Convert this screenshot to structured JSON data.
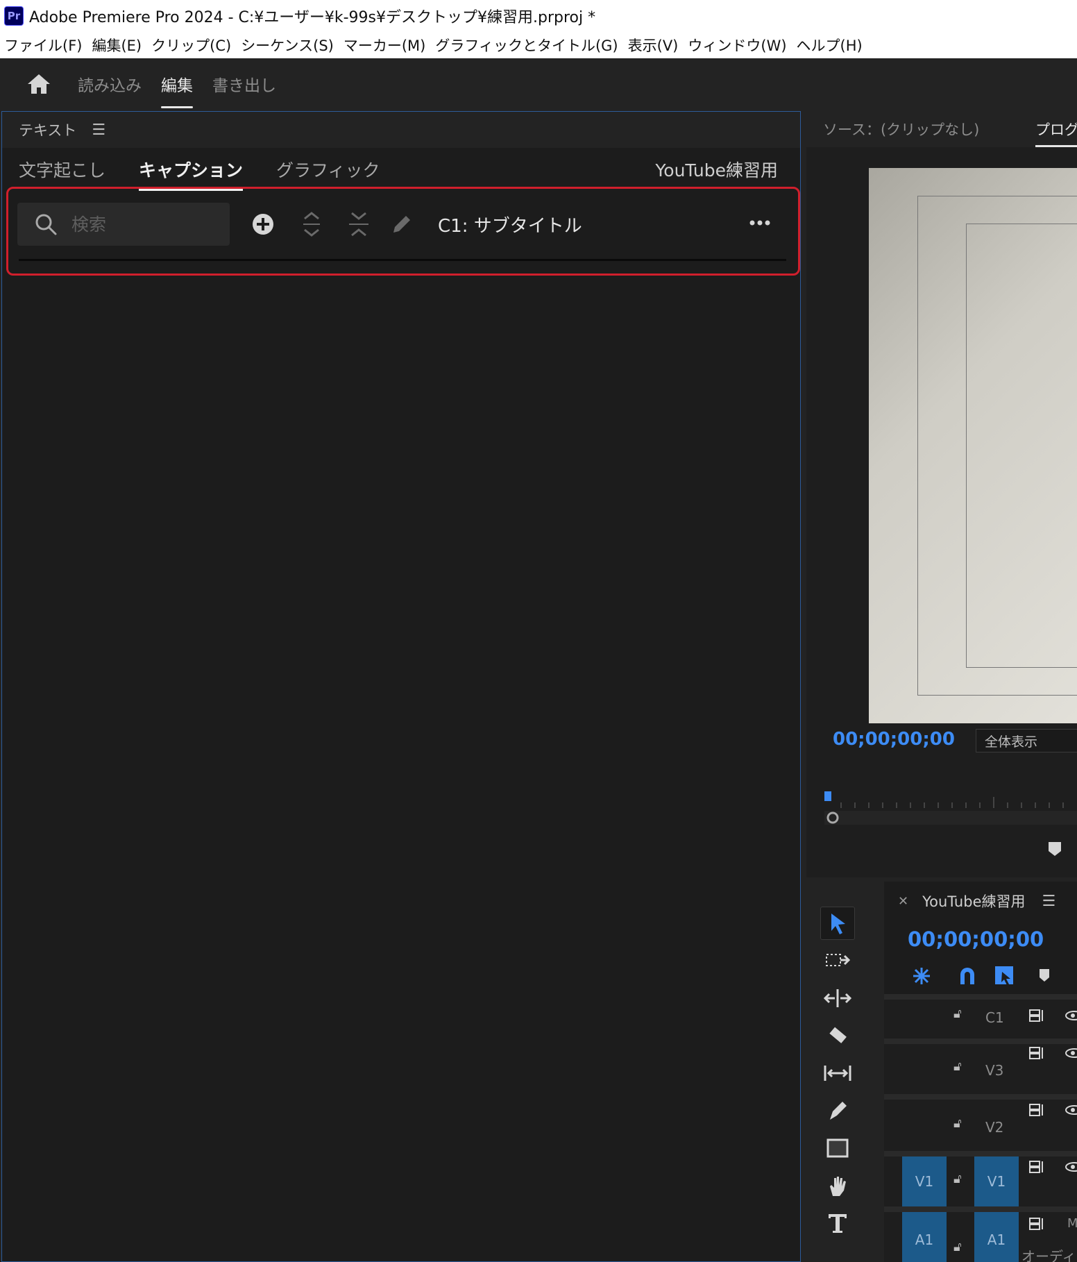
{
  "app": {
    "logo": "Pr",
    "title": "Adobe Premiere Pro 2024 - C:¥ユーザー¥k-99s¥デスクトップ¥練習用.prproj *"
  },
  "menu": [
    "ファイル(F)",
    "編集(E)",
    "クリップ(C)",
    "シーケンス(S)",
    "マーカー(M)",
    "グラフィックとタイトル(G)",
    "表示(V)",
    "ウィンドウ(W)",
    "ヘルプ(H)"
  ],
  "workspace": {
    "tabs": [
      "読み込み",
      "編集",
      "書き出し"
    ],
    "active": "編集"
  },
  "text_panel": {
    "title": "テキスト",
    "tabs": [
      "文字起こし",
      "キャプション",
      "グラフィック"
    ],
    "active_tab": "キャプション",
    "sequence_name": "YouTube練習用",
    "search_placeholder": "検索",
    "caption_track": "C1: サブタイトル"
  },
  "monitor": {
    "source_tab": "ソース：(クリップなし)",
    "program_tab": "プログ",
    "timecode": "00;00;00;00",
    "fit": "全体表示"
  },
  "timeline": {
    "name": "YouTube練習用",
    "timecode": "00;00;00;00",
    "tracks": {
      "c1": "C1",
      "v3": "V3",
      "v2": "V2",
      "v1_source": "V1",
      "v1": "V1",
      "a1_source": "A1",
      "a1": "A1",
      "audio_label": "オーディ",
      "m": "M"
    }
  },
  "colors": {
    "accent": "#3d8cf5",
    "highlight": "#d01f2c",
    "track_target": "#1c5a8a"
  }
}
